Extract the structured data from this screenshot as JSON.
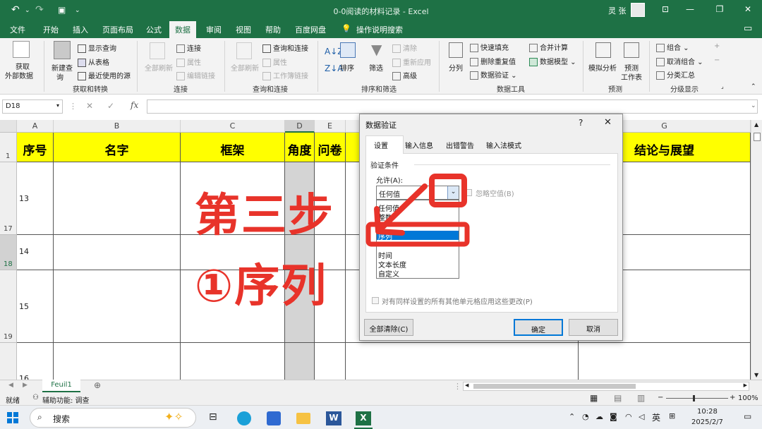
{
  "window": {
    "title": "0-0阅读的材料记录 - Excel",
    "user": "灵 张"
  },
  "menu": {
    "file": "文件",
    "tabs": [
      "开始",
      "插入",
      "页面布局",
      "公式",
      "数据",
      "审阅",
      "视图",
      "帮助",
      "百度网盘"
    ],
    "tell": "操作说明搜索",
    "active": "数据"
  },
  "ribbon": {
    "get_data": {
      "line1": "获取",
      "line2": "外部数据"
    },
    "new_query": {
      "line1": "新建查",
      "line2": "询"
    },
    "show_query": "显示查询",
    "from_table": "从表格",
    "recent_sources": "最近使用的源",
    "refresh_all": "全部刷新",
    "connections": "连接",
    "properties": "属性",
    "edit_links": "编辑链接",
    "refresh_all2": "全部刷新",
    "query_conn": "查询和连接",
    "properties2": "属性",
    "workbook_links": "工作簿链接",
    "sort": "排序",
    "filter": "筛选",
    "clear": "清除",
    "reapply": "重新应用",
    "advanced": "高级",
    "split": "分列",
    "flash_fill": "快速填充",
    "remove_dup": "删除重复值",
    "data_validation": "数据验证",
    "consolidate": "合并计算",
    "data_model": "数据模型",
    "whatif": "模拟分析",
    "forecast": {
      "line1": "预测",
      "line2": "工作表"
    },
    "group": "组合",
    "ungroup": "取消组合",
    "subtotal": "分类汇总",
    "groups": {
      "get_transform": "获取和转换",
      "connections": "连接",
      "query_conn": "查询和连接",
      "sort_filter": "排序和筛选",
      "data_tools": "数据工具",
      "forecast": "预测",
      "outline": "分级显示"
    }
  },
  "namebox": "D18",
  "columns": [
    "A",
    "B",
    "C",
    "D",
    "E",
    "G"
  ],
  "header_row": {
    "row": "1",
    "cells": [
      "序号",
      "名字",
      "框架",
      "角度",
      "问卷",
      "结论与展望"
    ]
  },
  "rows": [
    {
      "num": "17",
      "a": "13"
    },
    {
      "num": "18",
      "a": "14"
    },
    {
      "num": "19",
      "a": "15"
    },
    {
      "num": "",
      "a": "16"
    }
  ],
  "overlay": {
    "line1": "第三步",
    "line2": "①序列"
  },
  "dialog": {
    "title": "数据验证",
    "help": "?",
    "close": "✕",
    "tabs": [
      "设置",
      "输入信息",
      "出错警告",
      "输入法模式"
    ],
    "section": "验证条件",
    "allow_label": "允许(A):",
    "allow_value": "任何值",
    "ignore_blank": "忽略空值(B)",
    "options": [
      "任何值",
      "整数",
      "小数",
      "序列",
      "时间",
      "文本长度",
      "自定义"
    ],
    "selected_option": "序列",
    "apply_all": "对有同样设置的所有其他单元格应用这些更改(P)",
    "clear_all": "全部清除(C)",
    "ok": "确定",
    "cancel": "取消"
  },
  "sheet_tab": "Feuil1",
  "status": {
    "ready": "就绪",
    "accessibility": "辅助功能: 调查",
    "zoom": "100%"
  },
  "taskbar": {
    "search": "搜索",
    "ime": "英",
    "time": "10:28",
    "date": "2025/2/7"
  },
  "colors": {
    "excel_green": "#1e7145",
    "header_yellow": "#ffff00",
    "overlay_red": "#e8332a",
    "highlight_blue": "#0078d7"
  }
}
